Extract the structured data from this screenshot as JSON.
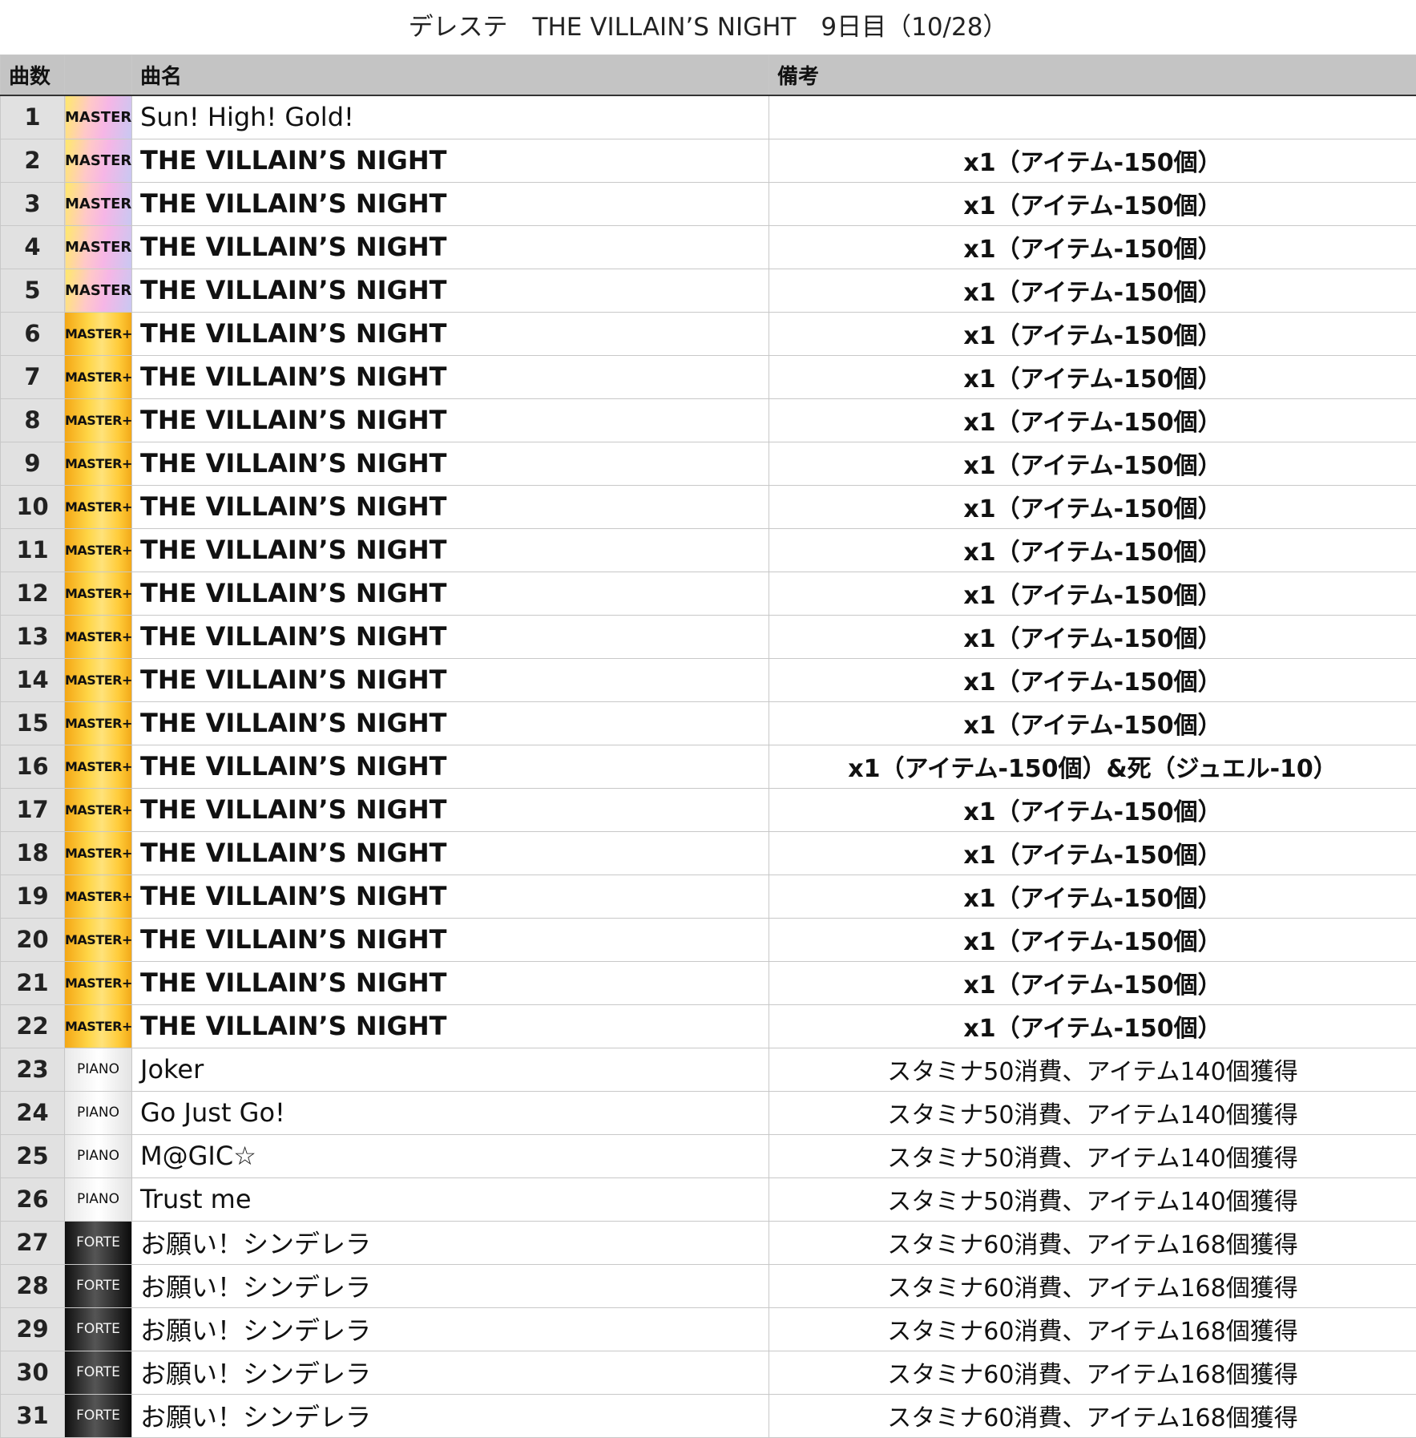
{
  "title": "デレステ　THE VILLAIN’S NIGHT　9日目（10/28）",
  "headers": [
    "曲数",
    "",
    "曲名",
    "備考"
  ],
  "colors": {
    "header_bg": "#c4c4c4",
    "number_bg": "#e1e1e1",
    "grid": "#c8c8c8"
  },
  "rows": [
    {
      "num": "1",
      "diff": "MASTER",
      "song": "Sun! High! Gold!",
      "note": ""
    },
    {
      "num": "2",
      "diff": "MASTER",
      "song": "THE VILLAIN’S NIGHT",
      "note": "x1（アイテム-150個）"
    },
    {
      "num": "3",
      "diff": "MASTER",
      "song": "THE VILLAIN’S NIGHT",
      "note": "x1（アイテム-150個）"
    },
    {
      "num": "4",
      "diff": "MASTER",
      "song": "THE VILLAIN’S NIGHT",
      "note": "x1（アイテム-150個）"
    },
    {
      "num": "5",
      "diff": "MASTER",
      "song": "THE VILLAIN’S NIGHT",
      "note": "x1（アイテム-150個）"
    },
    {
      "num": "6",
      "diff": "MASTER+",
      "song": "THE VILLAIN’S NIGHT",
      "note": "x1（アイテム-150個）"
    },
    {
      "num": "7",
      "diff": "MASTER+",
      "song": "THE VILLAIN’S NIGHT",
      "note": "x1（アイテム-150個）"
    },
    {
      "num": "8",
      "diff": "MASTER+",
      "song": "THE VILLAIN’S NIGHT",
      "note": "x1（アイテム-150個）"
    },
    {
      "num": "9",
      "diff": "MASTER+",
      "song": "THE VILLAIN’S NIGHT",
      "note": "x1（アイテム-150個）"
    },
    {
      "num": "10",
      "diff": "MASTER+",
      "song": "THE VILLAIN’S NIGHT",
      "note": "x1（アイテム-150個）"
    },
    {
      "num": "11",
      "diff": "MASTER+",
      "song": "THE VILLAIN’S NIGHT",
      "note": "x1（アイテム-150個）"
    },
    {
      "num": "12",
      "diff": "MASTER+",
      "song": "THE VILLAIN’S NIGHT",
      "note": "x1（アイテム-150個）"
    },
    {
      "num": "13",
      "diff": "MASTER+",
      "song": "THE VILLAIN’S NIGHT",
      "note": "x1（アイテム-150個）"
    },
    {
      "num": "14",
      "diff": "MASTER+",
      "song": "THE VILLAIN’S NIGHT",
      "note": "x1（アイテム-150個）"
    },
    {
      "num": "15",
      "diff": "MASTER+",
      "song": "THE VILLAIN’S NIGHT",
      "note": "x1（アイテム-150個）"
    },
    {
      "num": "16",
      "diff": "MASTER+",
      "song": "THE VILLAIN’S NIGHT",
      "note": "x1（アイテム-150個）&死（ジュエル-10）"
    },
    {
      "num": "17",
      "diff": "MASTER+",
      "song": "THE VILLAIN’S NIGHT",
      "note": "x1（アイテム-150個）"
    },
    {
      "num": "18",
      "diff": "MASTER+",
      "song": "THE VILLAIN’S NIGHT",
      "note": "x1（アイテム-150個）"
    },
    {
      "num": "19",
      "diff": "MASTER+",
      "song": "THE VILLAIN’S NIGHT",
      "note": "x1（アイテム-150個）"
    },
    {
      "num": "20",
      "diff": "MASTER+",
      "song": "THE VILLAIN’S NIGHT",
      "note": "x1（アイテム-150個）"
    },
    {
      "num": "21",
      "diff": "MASTER+",
      "song": "THE VILLAIN’S NIGHT",
      "note": "x1（アイテム-150個）"
    },
    {
      "num": "22",
      "diff": "MASTER+",
      "song": "THE VILLAIN’S NIGHT",
      "note": "x1（アイテム-150個）"
    },
    {
      "num": "23",
      "diff": "PIANO",
      "song": "Joker",
      "note": "スタミナ50消費、アイテム140個獲得"
    },
    {
      "num": "24",
      "diff": "PIANO",
      "song": "Go Just Go!",
      "note": "スタミナ50消費、アイテム140個獲得"
    },
    {
      "num": "25",
      "diff": "PIANO",
      "song": "M@GIC☆",
      "note": "スタミナ50消費、アイテム140個獲得"
    },
    {
      "num": "26",
      "diff": "PIANO",
      "song": "Trust me",
      "note": "スタミナ50消費、アイテム140個獲得"
    },
    {
      "num": "27",
      "diff": "FORTE",
      "song": "お願い！シンデレラ",
      "note": "スタミナ60消費、アイテム168個獲得"
    },
    {
      "num": "28",
      "diff": "FORTE",
      "song": "お願い！シンデレラ",
      "note": "スタミナ60消費、アイテム168個獲得"
    },
    {
      "num": "29",
      "diff": "FORTE",
      "song": "お願い！シンデレラ",
      "note": "スタミナ60消費、アイテム168個獲得"
    },
    {
      "num": "30",
      "diff": "FORTE",
      "song": "お願い！シンデレラ",
      "note": "スタミナ60消費、アイテム168個獲得"
    },
    {
      "num": "31",
      "diff": "FORTE",
      "song": "お願い！シンデレラ",
      "note": "スタミナ60消費、アイテム168個獲得"
    }
  ]
}
